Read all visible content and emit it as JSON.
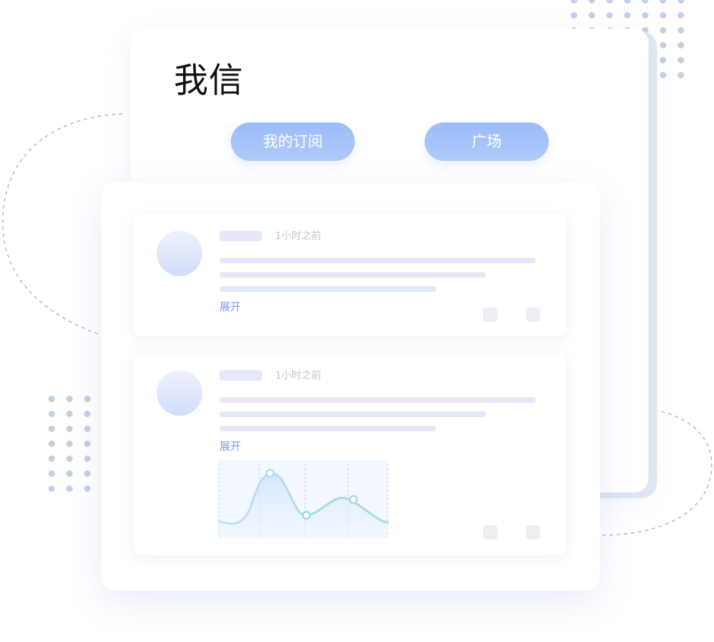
{
  "app": {
    "title": "我信"
  },
  "tabs": [
    {
      "label": "我的订阅"
    },
    {
      "label": "广场"
    }
  ],
  "posts": [
    {
      "time": "1小时之前",
      "expand": "展开"
    },
    {
      "time": "1小时之前",
      "expand": "展开"
    }
  ],
  "colors": {
    "tab_gradient": [
      "#9cbcf7",
      "#aecaf9"
    ],
    "link": "#7d9fe8",
    "placeholder": "#e4e8f6",
    "dot": "#c3cfe2",
    "chart_fill": "#dcebfb",
    "chart_line_blue": "#b5dcf3",
    "chart_line_teal": "#a4dcd8"
  },
  "icons": {
    "avatar": "avatar-placeholder",
    "action_a": "action-icon-placeholder",
    "action_b": "action-icon-placeholder"
  }
}
